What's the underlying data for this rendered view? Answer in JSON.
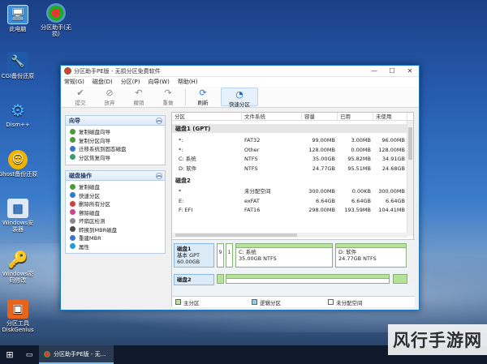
{
  "desktop": {
    "icons": [
      {
        "label": "此电脑",
        "icon": "computer-icon"
      },
      {
        "label": "分区助手(无损)",
        "icon": "partition-assistant-icon"
      },
      {
        "label": "CGI备份还原",
        "icon": "cgi-backup-icon"
      },
      {
        "label": "Dism++",
        "icon": "gear-icon"
      },
      {
        "label": "Ghost备份还原",
        "icon": "ghost-icon"
      },
      {
        "label": "Windows安装器",
        "icon": "windows-installer-icon"
      },
      {
        "label": "Windows密码修改",
        "icon": "key-icon"
      },
      {
        "label": "分区工具DiskGenius",
        "icon": "diskgenius-icon"
      }
    ]
  },
  "window": {
    "title": "分区助手PE版 - 无损分区免费软件",
    "menu": [
      "常规(G)",
      "磁盘(D)",
      "分区(P)",
      "向导(W)",
      "帮助(H)"
    ],
    "toolbar": [
      "提交",
      "放弃",
      "撤销",
      "重做",
      "刷新",
      "快速分区"
    ],
    "wizard_panel": {
      "title": "向导",
      "items": [
        "复制磁盘向导",
        "复制分区向导",
        "迁移系统到固态磁盘",
        "分区恢复向导"
      ]
    },
    "disk_ops_panel": {
      "title": "磁盘操作",
      "items": [
        "复制磁盘",
        "快速分区",
        "删除所有分区",
        "擦除磁盘",
        "坏扇区检测",
        "转换到MBR磁盘",
        "重建MBR",
        "属性"
      ]
    },
    "table": {
      "headers": [
        "分区",
        "文件系统",
        "容量",
        "已用",
        "未使用"
      ],
      "disks": [
        {
          "name": "磁盘1 (GPT)",
          "rows": [
            [
              "*:",
              "FAT32",
              "99.00MB",
              "3.00MB",
              "96.00MB"
            ],
            [
              "*:",
              "Other",
              "128.00MB",
              "0.00MB",
              "128.00MB"
            ],
            [
              "C: 系统",
              "NTFS",
              "35.00GB",
              "95.82MB",
              "34.91GB"
            ],
            [
              "D: 软件",
              "NTFS",
              "24.77GB",
              "95.51MB",
              "24.68GB"
            ]
          ]
        },
        {
          "name": "磁盘2",
          "rows": [
            [
              "*",
              "",
              "未分配空间",
              "300.00MB",
              "0.00KB",
              "300.00MB"
            ],
            [
              "E:",
              "exFAT",
              "6.64GB",
              "6.64GB",
              "6.64GB"
            ],
            [
              "F: EFI",
              "FAT16",
              "298.00MB",
              "193.59MB",
              "104.41MB"
            ]
          ]
        }
      ]
    },
    "disk_map": {
      "disk1": {
        "name": "磁盘1",
        "type": "基本 GPT",
        "size": "60.00GB"
      },
      "small_parts": [
        "9",
        "1"
      ],
      "part_c": {
        "label": "C: 系统",
        "detail": "35.00GB NTFS"
      },
      "part_d": {
        "label": "D: 软件",
        "detail": "24.77GB NTFS"
      },
      "disk2": {
        "name": "磁盘2"
      }
    },
    "legend": [
      "主分区",
      "逻辑分区",
      "未分配空间"
    ]
  },
  "taskbar": {
    "active_app": "分区助手PE版 - 无..."
  },
  "watermark": "风行手游网",
  "colors": {
    "accent": "#2b7bd3",
    "partition_green": "#b6e29a",
    "titlebar_border": "#1979ca"
  }
}
